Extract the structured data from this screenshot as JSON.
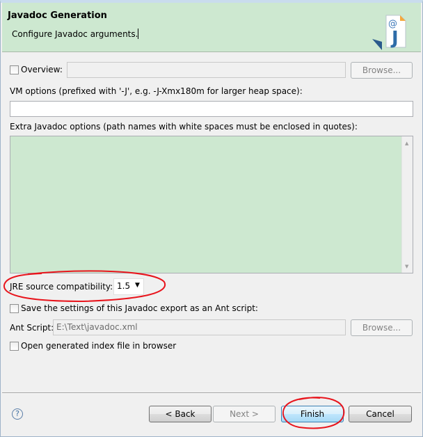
{
  "header": {
    "title": "Javadoc Generation",
    "subtitle": "Configure Javadoc arguments.",
    "icon": "javadoc-wizard-icon"
  },
  "overview": {
    "label": "Overview:",
    "checked": false,
    "value": "",
    "browse": "Browse..."
  },
  "vm_options": {
    "label": "VM options (prefixed with '-J', e.g. -J-Xmx180m for larger heap space):",
    "value": ""
  },
  "extra_options": {
    "label": "Extra Javadoc options (path names with white spaces must be enclosed in quotes):",
    "value": ""
  },
  "jre": {
    "label": "JRE source compatibility:",
    "value": "1.5"
  },
  "save_ant": {
    "label": "Save the settings of this Javadoc export as an Ant script:",
    "checked": false
  },
  "ant_script": {
    "label": "Ant Script:",
    "value": "E:\\Text\\javadoc.xml",
    "browse": "Browse..."
  },
  "open_index": {
    "label": "Open generated index file in browser",
    "checked": false
  },
  "footer": {
    "help": "?",
    "back": "< Back",
    "next": "Next >",
    "finish": "Finish",
    "cancel": "Cancel"
  },
  "colors": {
    "header_bg": "#cde8d0",
    "annotation": "#e8141c"
  }
}
